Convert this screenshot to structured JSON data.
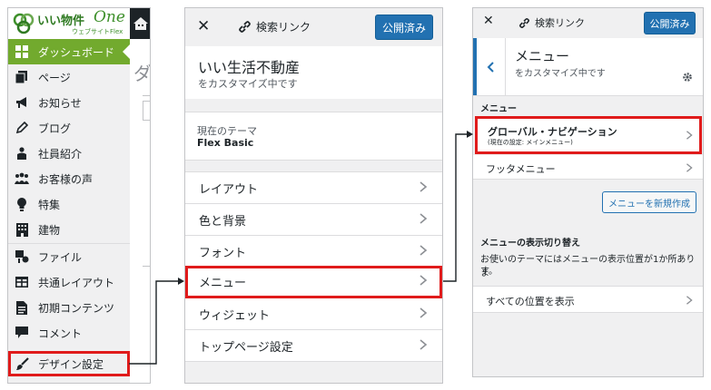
{
  "sidebar": {
    "logo": {
      "title": "いい物件",
      "italic": "One",
      "sub": "ウェブサイトFlex"
    },
    "items": [
      {
        "label": "ダッシュボード",
        "icon": "dashboard-icon",
        "active": true
      },
      {
        "label": "ページ",
        "icon": "pages-icon"
      },
      {
        "label": "お知らせ",
        "icon": "megaphone-icon"
      },
      {
        "label": "ブログ",
        "icon": "pencil-icon"
      },
      {
        "label": "社員紹介",
        "icon": "person-icon"
      },
      {
        "label": "お客様の声",
        "icon": "group-icon"
      },
      {
        "label": "特集",
        "icon": "lightbulb-icon"
      },
      {
        "label": "建物",
        "icon": "building-icon"
      },
      {
        "label": "ファイル",
        "icon": "media-icon"
      },
      {
        "label": "共通レイアウト",
        "icon": "table-icon"
      },
      {
        "label": "初期コンテンツ",
        "icon": "document-icon"
      },
      {
        "label": "コメント",
        "icon": "comment-icon"
      },
      {
        "label": "デザイン設定",
        "icon": "brush-icon",
        "highlighted": true
      }
    ],
    "partial_heading": "ダ"
  },
  "customizer": {
    "close": "✕",
    "search_label": "検索リンク",
    "publish_label": "公開済み",
    "site_title": "いい生活不動産",
    "site_sub": "をカスタマイズ中です",
    "theme_caption": "現在のテーマ",
    "theme_name": "Flex Basic",
    "sections": [
      {
        "label": "レイアウト"
      },
      {
        "label": "色と背景"
      },
      {
        "label": "フォント"
      },
      {
        "label": "メニュー",
        "highlighted": true
      },
      {
        "label": "ウィジェット"
      },
      {
        "label": "トップページ設定"
      }
    ]
  },
  "menus_panel": {
    "close": "✕",
    "search_label": "検索リンク",
    "publish_label": "公開済み",
    "section_title": "メニュー",
    "section_sub": "をカスタマイズ中です",
    "group_heading": "メニュー",
    "locations": [
      {
        "label": "グローバル・ナビゲーション",
        "note": "(現在の設定: メインメニュー)",
        "highlighted": true
      },
      {
        "label": "フッタメニュー",
        "note": ""
      }
    ],
    "create_button": "メニューを新規作成",
    "toggle_heading": "メニューの表示切り替え",
    "toggle_desc": "お使いのテーマにはメニューの表示位置が1か所ありま",
    "toggle_desc2": "す。",
    "view_all": "すべての位置を表示"
  },
  "colors": {
    "accent": "#2271b1",
    "highlight": "#e01b1b",
    "active_menu": "#72aa2e",
    "logo_green": "#3d8f2a"
  }
}
